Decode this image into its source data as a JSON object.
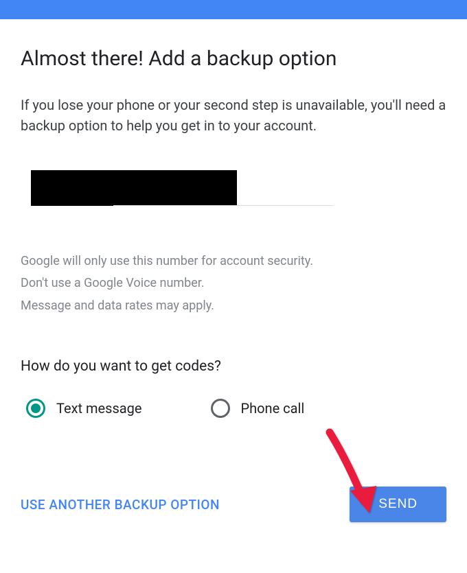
{
  "header": {
    "title": "Almost there! Add a backup option"
  },
  "description": "If you lose your phone or your second step is unavailable, you'll need a backup option to help you get in to your account.",
  "phoneField": {
    "value": ""
  },
  "disclaimer": {
    "line1": "Google will only use this number for account security.",
    "line2": "Don't use a Google Voice number.",
    "line3": "Message and data rates may apply."
  },
  "codeMethod": {
    "question": "How do you want to get codes?",
    "options": [
      {
        "label": "Text message",
        "selected": true
      },
      {
        "label": "Phone call",
        "selected": false
      }
    ]
  },
  "footer": {
    "secondaryLink": "USE ANOTHER BACKUP OPTION",
    "primaryButton": "SEND"
  }
}
